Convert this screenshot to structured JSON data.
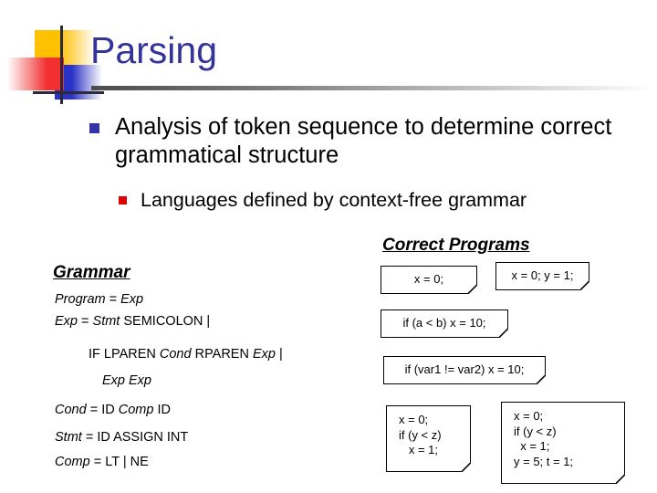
{
  "slide": {
    "title": "Parsing",
    "logo": {
      "yellow_swatch": "#FFC000",
      "red_swatch": "#F23030",
      "blue_swatch": "#2A32C8",
      "rule_color": "#4C4C4C"
    },
    "title_color": "#333399"
  },
  "bullets": {
    "level1": {
      "marker_color": "#3333AA",
      "text": "Analysis of token sequence to determine correct grammatical structure"
    },
    "level2": {
      "marker_color": "#E00000",
      "text": "Languages defined by context-free grammar"
    }
  },
  "grammar": {
    "heading": "Grammar",
    "rules": [
      {
        "indent": 0,
        "parts": [
          {
            "t": "Program",
            "italic": true
          },
          {
            "t": " = ",
            "italic": false
          },
          {
            "t": "Exp",
            "italic": true
          }
        ]
      },
      {
        "indent": 0,
        "parts": [
          {
            "t": "Exp",
            "italic": true
          },
          {
            "t": " = ",
            "italic": false
          },
          {
            "t": "Stmt",
            "italic": true
          },
          {
            "t": " SEMICOLON |",
            "italic": false
          }
        ]
      },
      {
        "indent": 1,
        "parts": [
          {
            "t": "IF LPAREN ",
            "italic": false
          },
          {
            "t": "Cond",
            "italic": true
          },
          {
            "t": " RPAREN ",
            "italic": false
          },
          {
            "t": "Exp",
            "italic": true
          },
          {
            "t": " |",
            "italic": false
          }
        ]
      },
      {
        "indent": 1,
        "parts": [
          {
            "t": "Exp Exp",
            "italic": true
          }
        ]
      },
      {
        "indent": 0,
        "parts": [
          {
            "t": "Cond",
            "italic": true
          },
          {
            "t": " = ID ",
            "italic": false
          },
          {
            "t": "Comp",
            "italic": true
          },
          {
            "t": " ID",
            "italic": false
          }
        ]
      },
      {
        "indent": 0,
        "parts": [
          {
            "t": "Stmt",
            "italic": true
          },
          {
            "t": " = ID ASSIGN INT",
            "italic": false
          }
        ]
      },
      {
        "indent": 0,
        "parts": [
          {
            "t": "Comp",
            "italic": true
          },
          {
            "t": " = LT  |  NE",
            "italic": false
          }
        ]
      }
    ]
  },
  "correct_programs": {
    "heading": "Correct Programs",
    "samples": [
      {
        "code": "x = 0;"
      },
      {
        "code": "x = 0; y = 1;"
      },
      {
        "code": "if (a < b) x = 10;"
      },
      {
        "code": "if (var1 != var2) x = 10;"
      },
      {
        "code": "x = 0;\nif (y < z)\n   x = 1;"
      },
      {
        "code": "x = 0;\nif (y < z)\n  x = 1;\ny = 5; t = 1;"
      }
    ]
  }
}
